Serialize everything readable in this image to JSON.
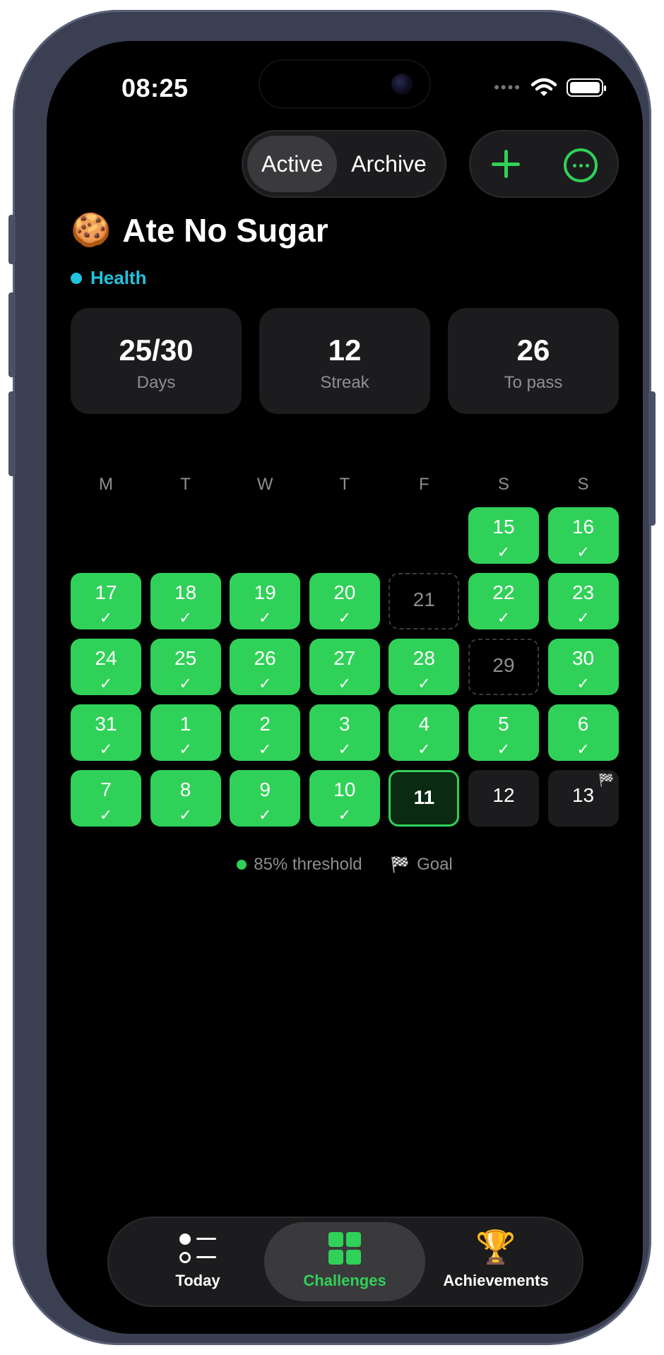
{
  "status_bar": {
    "time": "08:25"
  },
  "header": {
    "segments": [
      "Active",
      "Archive"
    ],
    "selected_segment": "Active",
    "add_icon": "plus-icon",
    "more_icon": "ellipsis-circle-icon"
  },
  "challenge": {
    "emoji": "🍪",
    "title": "Ate No Sugar",
    "category": "Health",
    "category_color": "#21c3e0"
  },
  "stats": [
    {
      "value": "25/30",
      "label": "Days"
    },
    {
      "value": "12",
      "label": "Streak"
    },
    {
      "value": "26",
      "label": "To pass"
    }
  ],
  "calendar": {
    "weekdays": [
      "M",
      "T",
      "W",
      "T",
      "F",
      "S",
      "S"
    ],
    "check": "✓",
    "flag": "🏁",
    "cells": [
      {
        "day": "",
        "state": "empty"
      },
      {
        "day": "",
        "state": "empty"
      },
      {
        "day": "",
        "state": "empty"
      },
      {
        "day": "",
        "state": "empty"
      },
      {
        "day": "",
        "state": "empty"
      },
      {
        "day": "15",
        "state": "done"
      },
      {
        "day": "16",
        "state": "done"
      },
      {
        "day": "17",
        "state": "done"
      },
      {
        "day": "18",
        "state": "done"
      },
      {
        "day": "19",
        "state": "done"
      },
      {
        "day": "20",
        "state": "done"
      },
      {
        "day": "21",
        "state": "missed"
      },
      {
        "day": "22",
        "state": "done"
      },
      {
        "day": "23",
        "state": "done"
      },
      {
        "day": "24",
        "state": "done"
      },
      {
        "day": "25",
        "state": "done"
      },
      {
        "day": "26",
        "state": "done"
      },
      {
        "day": "27",
        "state": "done"
      },
      {
        "day": "28",
        "state": "done"
      },
      {
        "day": "29",
        "state": "missed"
      },
      {
        "day": "30",
        "state": "done"
      },
      {
        "day": "31",
        "state": "done"
      },
      {
        "day": "1",
        "state": "done"
      },
      {
        "day": "2",
        "state": "done"
      },
      {
        "day": "3",
        "state": "done"
      },
      {
        "day": "4",
        "state": "done"
      },
      {
        "day": "5",
        "state": "done"
      },
      {
        "day": "6",
        "state": "done"
      },
      {
        "day": "7",
        "state": "done"
      },
      {
        "day": "8",
        "state": "done"
      },
      {
        "day": "9",
        "state": "done"
      },
      {
        "day": "10",
        "state": "done"
      },
      {
        "day": "11",
        "state": "today"
      },
      {
        "day": "12",
        "state": "future"
      },
      {
        "day": "13",
        "state": "future",
        "goal": true
      }
    ]
  },
  "legend": {
    "threshold": "85% threshold",
    "goal": "Goal"
  },
  "tabbar": {
    "tabs": [
      {
        "label": "Today",
        "icon": "checklist-icon"
      },
      {
        "label": "Challenges",
        "icon": "grid-icon",
        "selected": true
      },
      {
        "label": "Achievements",
        "icon": "trophy-icon"
      }
    ]
  },
  "colors": {
    "accent": "#30d158",
    "background": "#000000",
    "card": "#1c1c1e"
  }
}
